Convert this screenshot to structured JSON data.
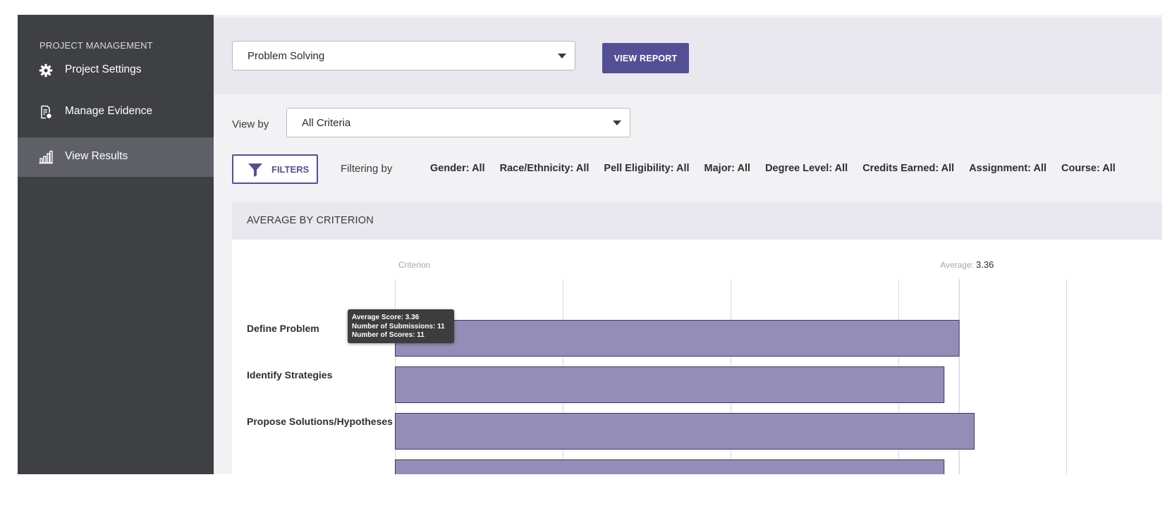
{
  "sidebar": {
    "section_title": "PROJECT MANAGEMENT",
    "items": [
      {
        "label": "Project Settings",
        "icon": "gear-icon"
      },
      {
        "label": "Manage Evidence",
        "icon": "document-settings-icon"
      },
      {
        "label": "View Results",
        "icon": "bar-chart-icon",
        "active": true
      }
    ]
  },
  "toolbar": {
    "report_select_value": "Problem Solving",
    "view_report_label": "VIEW REPORT"
  },
  "view_by": {
    "label": "View by",
    "select_value": "All Criteria"
  },
  "filters": {
    "button_label": "FILTERS",
    "filtering_by_label": "Filtering by",
    "chips": [
      "Gender: All",
      "Race/Ethnicity: All",
      "Pell Eligibility: All",
      "Major: All",
      "Degree Level: All",
      "Credits Earned: All",
      "Assignment: All",
      "Course: All"
    ]
  },
  "card": {
    "title": "AVERAGE BY CRITERION"
  },
  "tooltip": {
    "line1": "Average Score: 3.36",
    "line2": "Number of Submissions: 11",
    "line3": "Number of Scores: 11"
  },
  "colors": {
    "sidebar_bg": "#3f4044",
    "sidebar_active": "#5f6067",
    "accent": "#544f95",
    "bar_fill": "#948db7",
    "bar_stroke": "#3e3a66"
  },
  "chart_data": {
    "type": "bar",
    "orientation": "horizontal",
    "category_header": "Criterion",
    "average_label": "Average:",
    "average_value": 3.36,
    "categories": [
      "Define Problem",
      "Identify Strategies",
      "Propose Solutions/Hypotheses",
      ""
    ],
    "values": [
      3.36,
      3.27,
      3.45,
      3.27
    ],
    "xlim": [
      0,
      4
    ],
    "grid": true
  }
}
